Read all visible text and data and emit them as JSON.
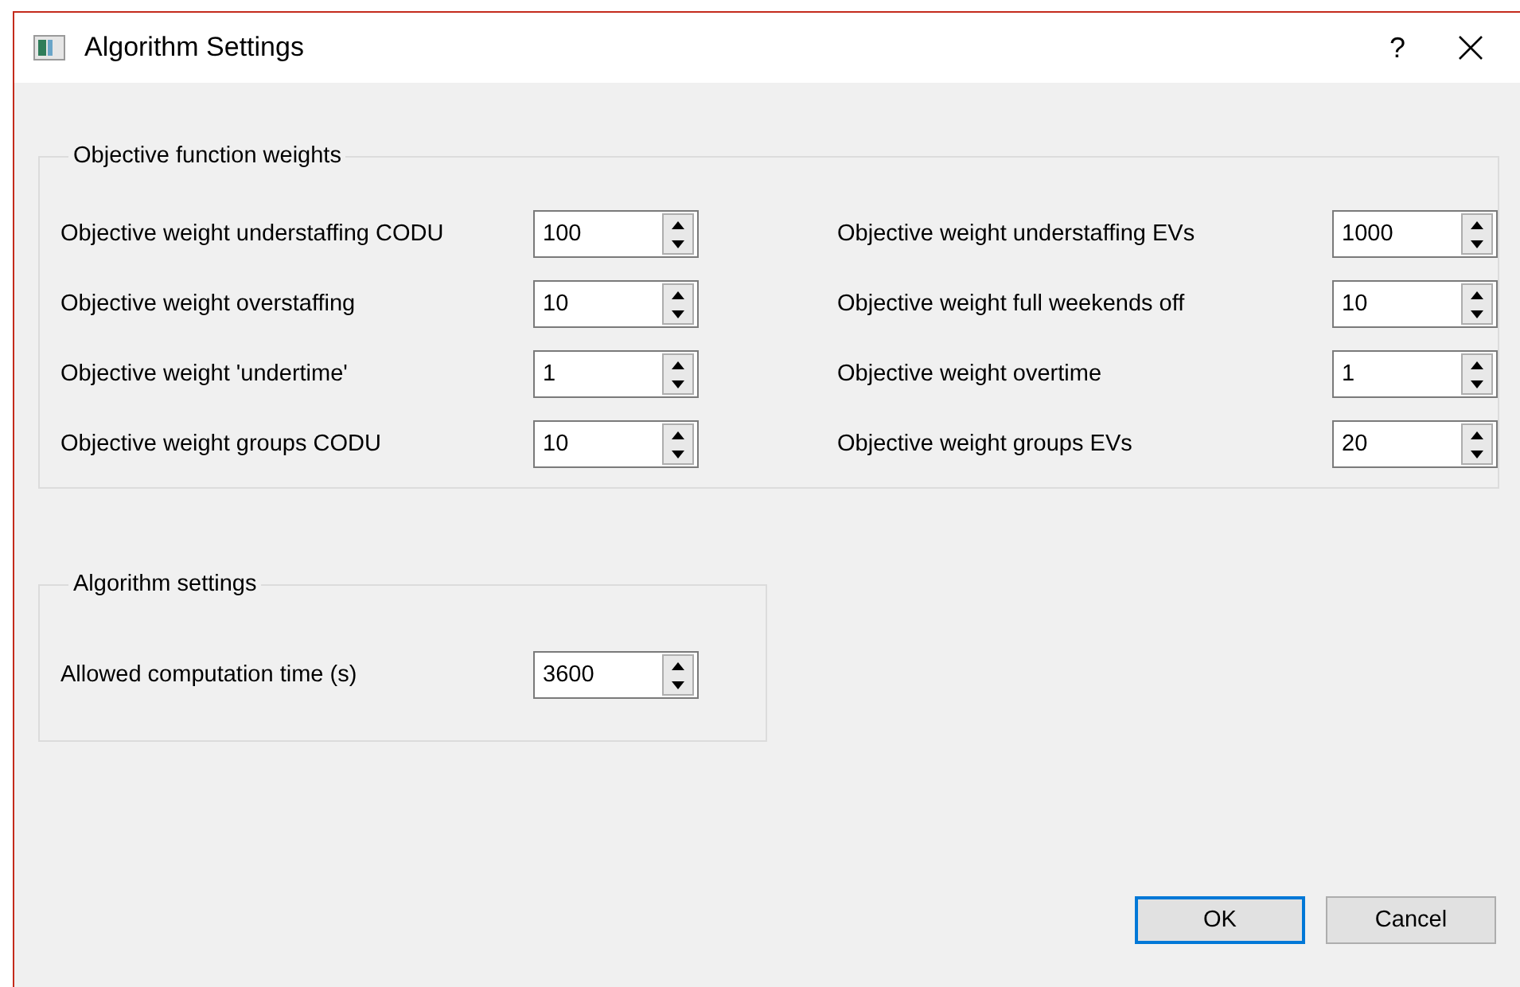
{
  "window": {
    "title": "Algorithm Settings",
    "help": "?"
  },
  "groups": [
    {
      "title": "Objective function weights",
      "kind": "wide",
      "fields": [
        {
          "label": "Objective weight understaffing CODU",
          "value": "100"
        },
        {
          "label": "Objective weight understaffing EVs",
          "value": "1000"
        },
        {
          "label": "Objective weight overstaffing",
          "value": "10"
        },
        {
          "label": "Objective weight full weekends off",
          "value": "10"
        },
        {
          "label": "Objective weight 'undertime'",
          "value": "1"
        },
        {
          "label": "Objective weight overtime",
          "value": "1"
        },
        {
          "label": "Objective weight groups CODU",
          "value": "10"
        },
        {
          "label": "Objective weight groups EVs",
          "value": "20"
        }
      ]
    },
    {
      "title": "Algorithm settings",
      "kind": "narrow",
      "fields": [
        {
          "label": "Allowed computation time (s)",
          "value": "3600"
        }
      ]
    }
  ],
  "buttons": [
    {
      "label": "OK",
      "default": true
    },
    {
      "label": "Cancel",
      "default": false
    }
  ]
}
